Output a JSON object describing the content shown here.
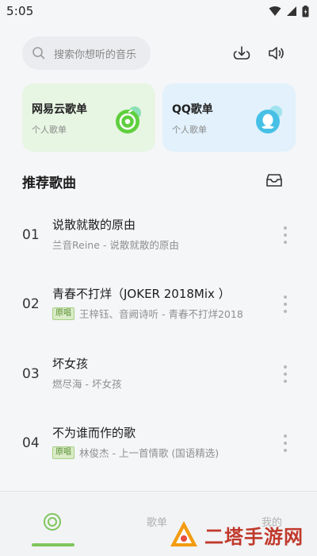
{
  "status_bar": {
    "time": "5:05"
  },
  "search": {
    "placeholder": "搜索你想听的音乐"
  },
  "cards": [
    {
      "title": "网易云歌单",
      "subtitle": "个人歌单",
      "icon": "netease-music-icon",
      "bg": "#e7f5e3"
    },
    {
      "title": "QQ歌单",
      "subtitle": "个人歌单",
      "icon": "qq-penguin-icon",
      "bg": "#e2f1fb"
    }
  ],
  "section": {
    "title": "推荐歌曲"
  },
  "songs": [
    {
      "num": "01",
      "title": "说散就散的原由",
      "badge": "",
      "subtitle": "兰音Reine - 说散就散的原由"
    },
    {
      "num": "02",
      "title": "青春不打烊（JOKER 2018Mix ）",
      "badge": "原唱",
      "subtitle": "王梓钰、音阙诗听 - 青春不打烊2018"
    },
    {
      "num": "03",
      "title": "坏女孩",
      "badge": "",
      "subtitle": "燃尽海 - 坏女孩"
    },
    {
      "num": "04",
      "title": "不为谁而作的歌",
      "badge": "原唱",
      "subtitle": "林俊杰 - 上一首情歌 (国语精选)"
    }
  ],
  "bottom_nav": {
    "item2": "歌单",
    "item3": "我的"
  },
  "watermark": {
    "text": "二塔手游网"
  },
  "colors": {
    "accent": "#7ec65c",
    "badge_text": "#5a8f32",
    "watermark": "#c0392b"
  }
}
